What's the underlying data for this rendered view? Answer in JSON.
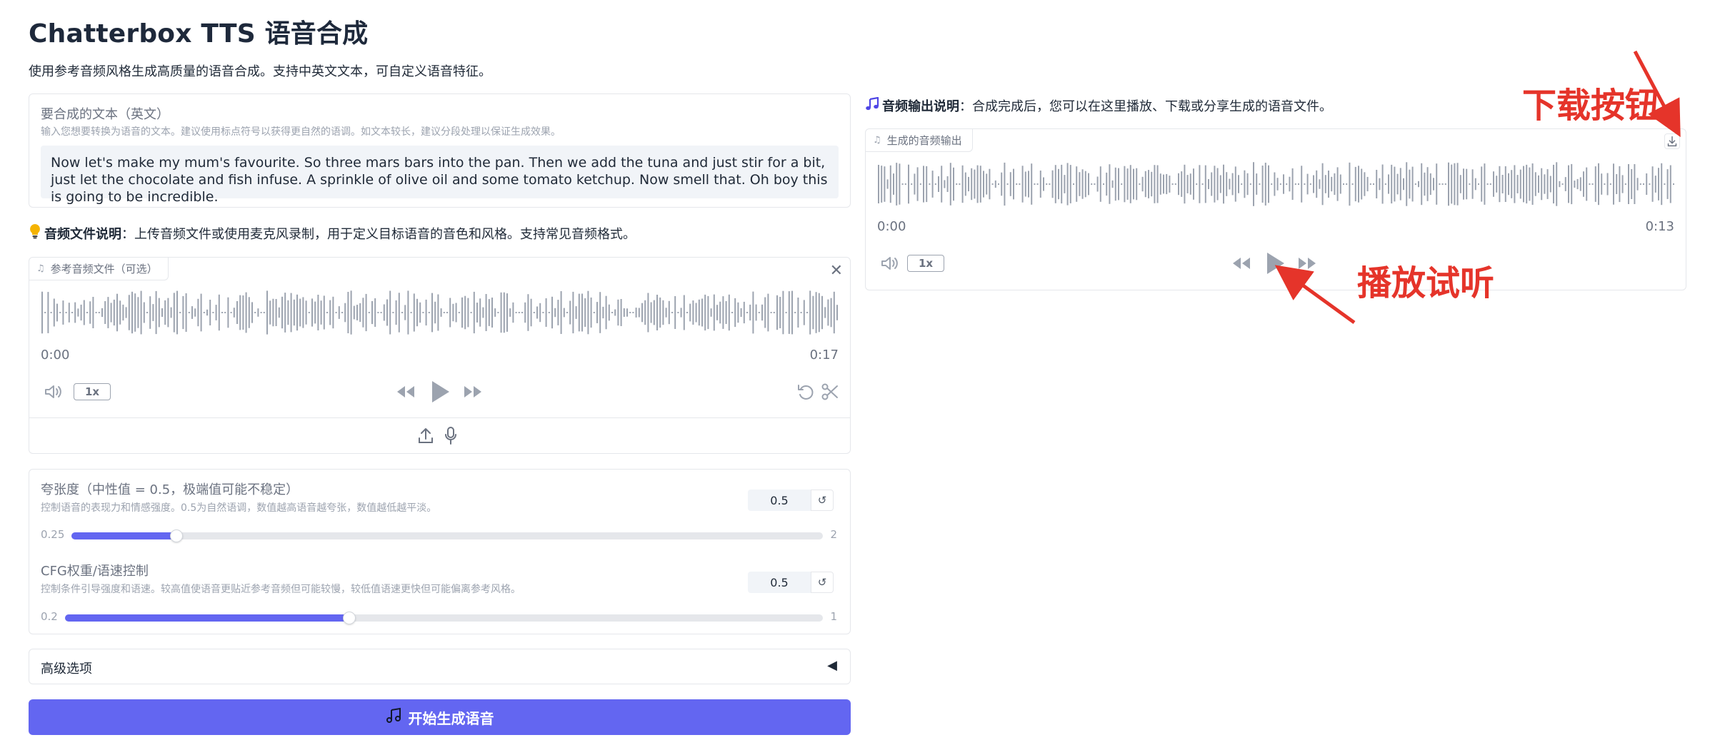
{
  "header": {
    "title": "Chatterbox TTS 语音合成",
    "description": "使用参考音频风格生成高质量的语音合成。支持中英文文本，可自定义语音特征。"
  },
  "text_input": {
    "label": "要合成的文本（英文）",
    "info": "输入您想要转换为语音的文本。建议使用标点符号以获得更自然的语调。如文本较长，建议分段处理以保证生成效果。",
    "value": "Now let's make my mum's favourite. So three mars bars into the pan. Then we add the tuna and just stir for a bit, just let the chocolate and fish infuse. A sprinkle of olive oil and some tomato ketchup. Now smell that. Oh boy this is going to be incredible."
  },
  "audio_file_note": {
    "icon": "lightbulb-icon",
    "title": "音频文件说明",
    "text": "：上传音频文件或使用麦克风录制，用于定义目标语音的音色和风格。支持常见音频格式。"
  },
  "reference_audio": {
    "label": "参考音频文件（可选）",
    "current_time": "0:00",
    "duration": "0:17",
    "speed": "1x",
    "progress": 0
  },
  "output_note": {
    "icon": "music-note-icon",
    "title": "音频输出说明",
    "text": "：合成完成后，您可以在这里播放、下载或分享生成的语音文件。"
  },
  "output_audio": {
    "label": "生成的音频输出",
    "current_time": "0:00",
    "duration": "0:13",
    "speed": "1x",
    "progress": 0
  },
  "sliders": [
    {
      "label": "夸张度（中性值 = 0.5，极端值可能不稳定）",
      "info": "控制语音的表现力和情感强度。0.5为自然语调，数值越高语音越夸张，数值越低越平淡。",
      "value": "0.5",
      "min": "0.25",
      "max": "2",
      "fraction": 0.14
    },
    {
      "label": "CFG权重/语速控制",
      "info": "控制条件引导强度和语速。较高值使语音更贴近参考音频但可能较慢，较低值语速更快但可能偏离参考风格。",
      "value": "0.5",
      "min": "0.2",
      "max": "1",
      "fraction": 0.375
    }
  ],
  "advanced": {
    "label": "高级选项",
    "arrow": "◀"
  },
  "generate_button": {
    "label": "开始生成语音"
  },
  "annotations": {
    "download": "下载按钮",
    "play": "播放试听"
  },
  "colors": {
    "accent": "#6366f1",
    "annotation_red": "#e5342a",
    "wave_gray": "#9ca3af"
  }
}
